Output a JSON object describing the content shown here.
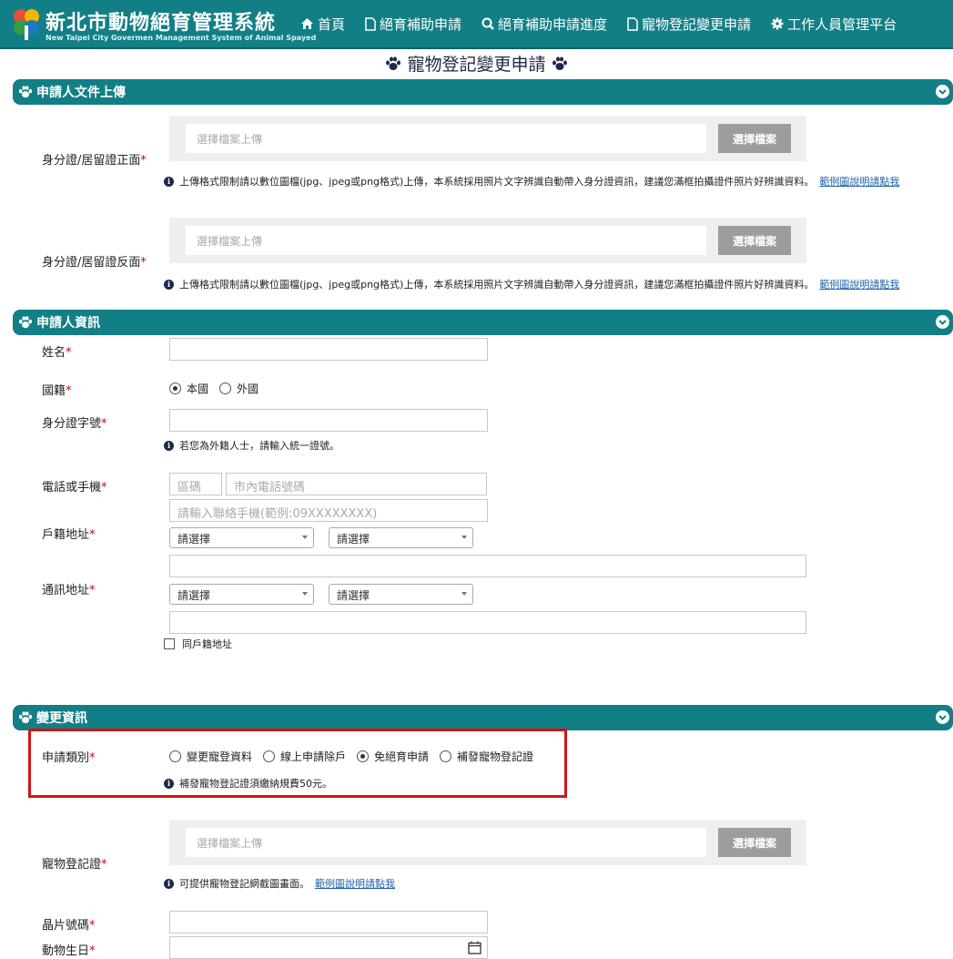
{
  "header": {
    "title": "新北市動物絕育管理系統",
    "subtitle": "New Taipei City Govermen Management System of Animal Spayed",
    "nav": [
      {
        "label": "首頁",
        "icon": "home-icon"
      },
      {
        "label": "絕育補助申請",
        "icon": "file-icon"
      },
      {
        "label": "絕育補助申請進度",
        "icon": "search-icon"
      },
      {
        "label": "寵物登記變更申請",
        "icon": "file-icon"
      },
      {
        "label": "工作人員管理平台",
        "icon": "gear-icon"
      }
    ]
  },
  "page_title": "寵物登記變更申請",
  "sections": {
    "upload": {
      "title": "申請人文件上傳",
      "id_front_label": "身分證/居留證正面",
      "id_back_label": "身分證/居留證反面",
      "upload_placeholder": "選擇檔案上傳",
      "upload_button": "選擇檔案",
      "hint_text": "上傳格式限制請以數位圖檔(jpg、jpeg或png格式)上傳，本系統採用照片文字辨識自動帶入身分證資訊，建議您滿框拍攝證件照片好辨識資料。",
      "hint_link": "範例圖說明請點我"
    },
    "applicant": {
      "title": "申請人資訊",
      "name_label": "姓名",
      "nationality_label": "國籍",
      "nationality_options": [
        "本國",
        "外國"
      ],
      "nationality_selected": "本國",
      "id_label": "身分證字號",
      "id_hint": "若您為外籍人士，請輸入統一證號。",
      "phone_label": "電話或手機",
      "area_code_placeholder": "區碼",
      "local_phone_placeholder": "市內電話號碼",
      "mobile_placeholder": "請輸入聯絡手機(範例:09XXXXXXXX)",
      "household_label": "戶籍地址",
      "mailing_label": "通訊地址",
      "select_placeholder": "請選擇",
      "same_address_label": "同戶籍地址"
    },
    "change": {
      "title": "變更資訊",
      "type_label": "申請類別",
      "type_options": [
        "變更寵登資料",
        "線上申請除戶",
        "免絕育申請",
        "補發寵物登記證"
      ],
      "type_selected": "免絕育申請",
      "type_hint": "補發寵物登記證須繳納規費50元。",
      "certificate_label": "寵物登記證",
      "certificate_hint": "可提供寵物登記網截圖畫面。",
      "certificate_link": "範例圖說明請點我",
      "chip_label": "晶片號碼",
      "birthday_label": "動物生日"
    }
  },
  "colors": {
    "header": "#127f86",
    "required": "#d0021b",
    "highlight": "#d21313"
  }
}
